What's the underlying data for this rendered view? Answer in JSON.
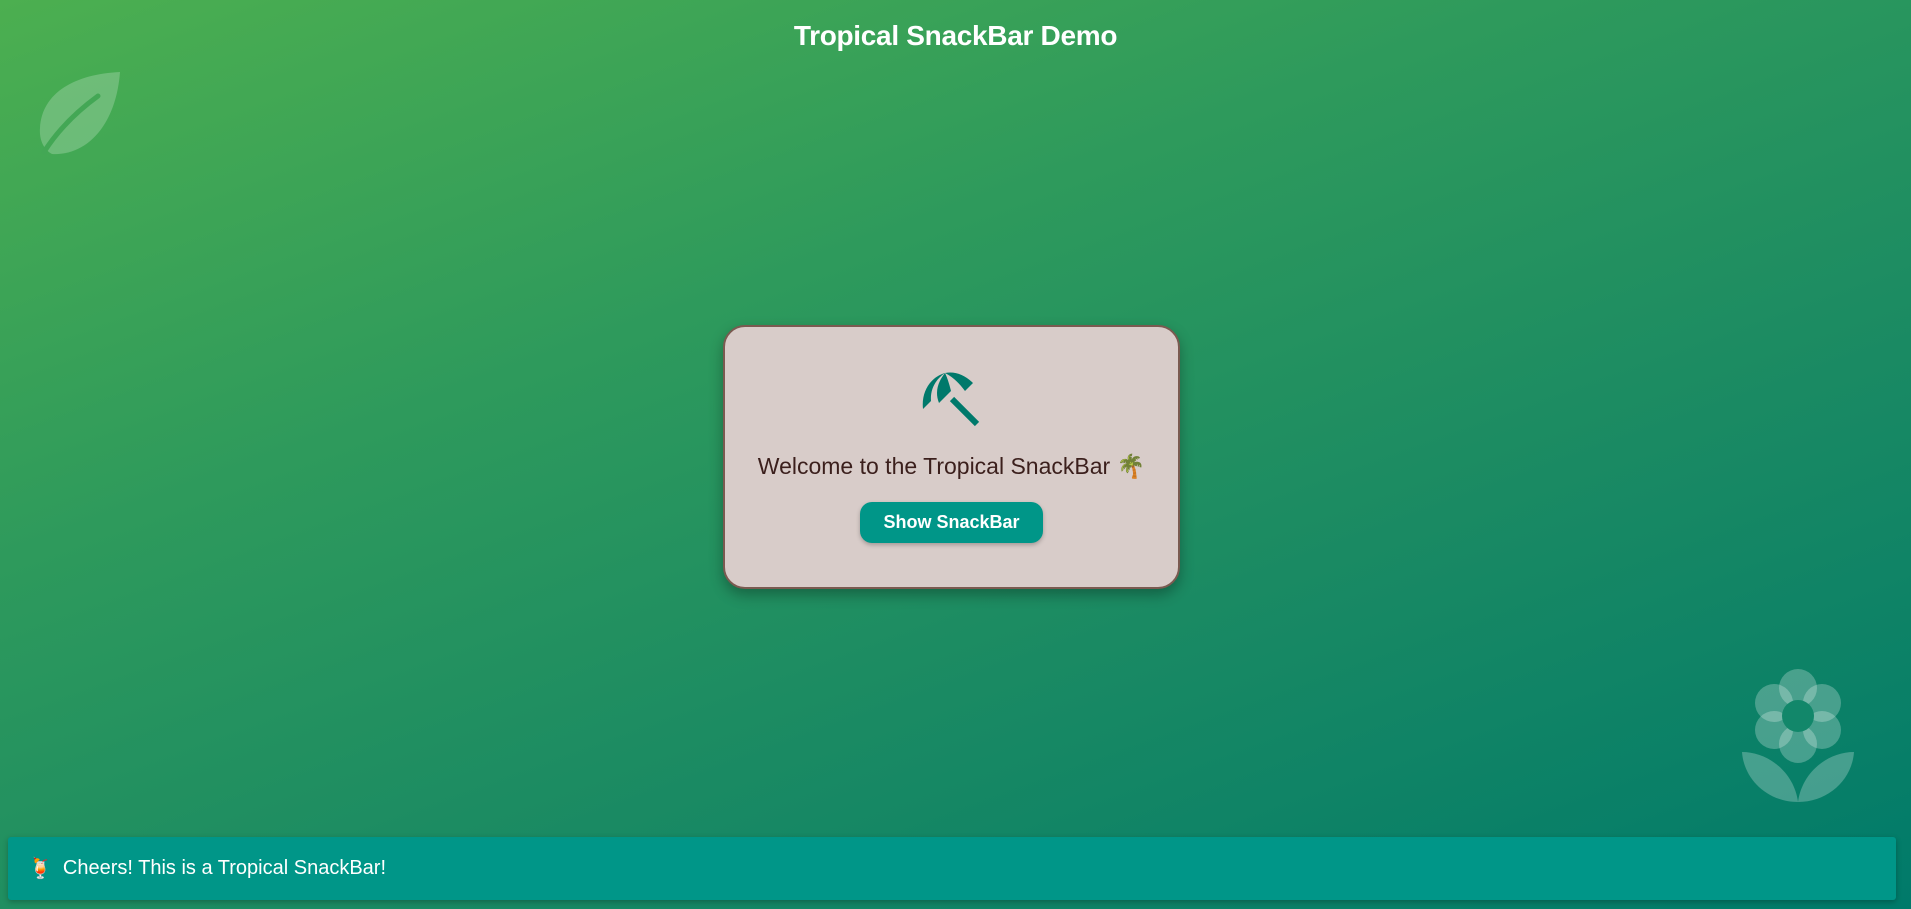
{
  "app_bar": {
    "title": "Tropical SnackBar Demo"
  },
  "decorations": {
    "top_left_icon": "leaf-icon",
    "bottom_right_icon": "flower-icon"
  },
  "card": {
    "icon": "beach-umbrella-icon",
    "welcome_text": "Welcome to the Tropical SnackBar 🌴",
    "button_label": "Show SnackBar"
  },
  "snackbar": {
    "emoji": "🍹",
    "message": "Cheers! This is a Tropical SnackBar!"
  },
  "colors": {
    "gradient_start": "#4caf50",
    "gradient_end": "#007a6a",
    "card_background": "#d8ccc9",
    "card_border": "#7a5a50",
    "accent": "#009688",
    "welcome_text": "#3b1f1c"
  }
}
